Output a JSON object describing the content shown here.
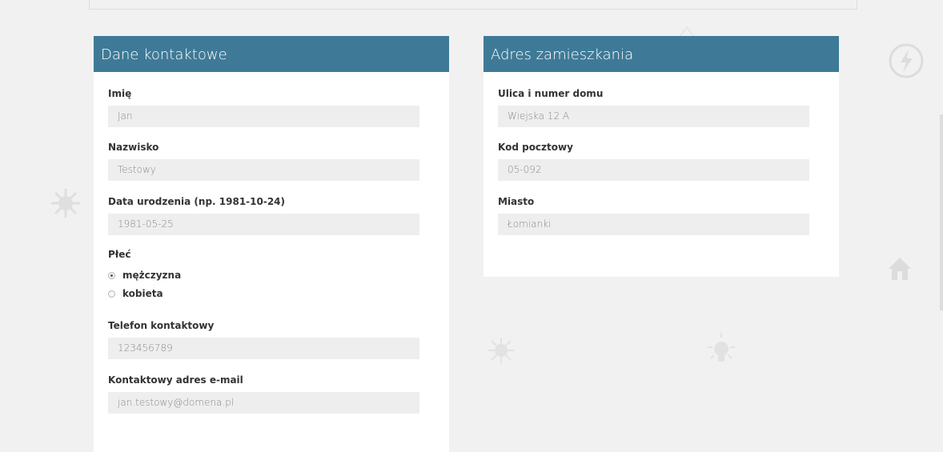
{
  "colors": {
    "panel_header": "#3e7a97",
    "input_bg": "#eeeeee",
    "page_bg": "#f1f1f1"
  },
  "contact": {
    "title": "Dane kontaktowe",
    "first_name": {
      "label": "Imię",
      "value": "Jan"
    },
    "last_name": {
      "label": "Nazwisko",
      "value": "Testowy"
    },
    "birth_date": {
      "label": "Data urodzenia (np. 1981-10-24)",
      "value": "1981-05-25"
    },
    "gender": {
      "label": "Płeć",
      "options": [
        {
          "label": "mężczyzna",
          "selected": true
        },
        {
          "label": "kobieta",
          "selected": false
        }
      ]
    },
    "phone": {
      "label": "Telefon kontaktowy",
      "value": "123456789"
    },
    "email": {
      "label": "Kontaktowy adres e-mail",
      "value": "jan.testowy@domena.pl"
    }
  },
  "address": {
    "title": "Adres zamieszkania",
    "street": {
      "label": "Ulica i numer domu",
      "value": "Wiejska 12 A"
    },
    "postal_code": {
      "label": "Kod pocztowy",
      "value": "05-092"
    },
    "city": {
      "label": "Miasto",
      "value": "Łomianki"
    }
  },
  "background_icons": [
    "power-icon",
    "house-icon",
    "sun-icon",
    "lightbulb-icon",
    "sun-icon",
    "warning-icon"
  ]
}
